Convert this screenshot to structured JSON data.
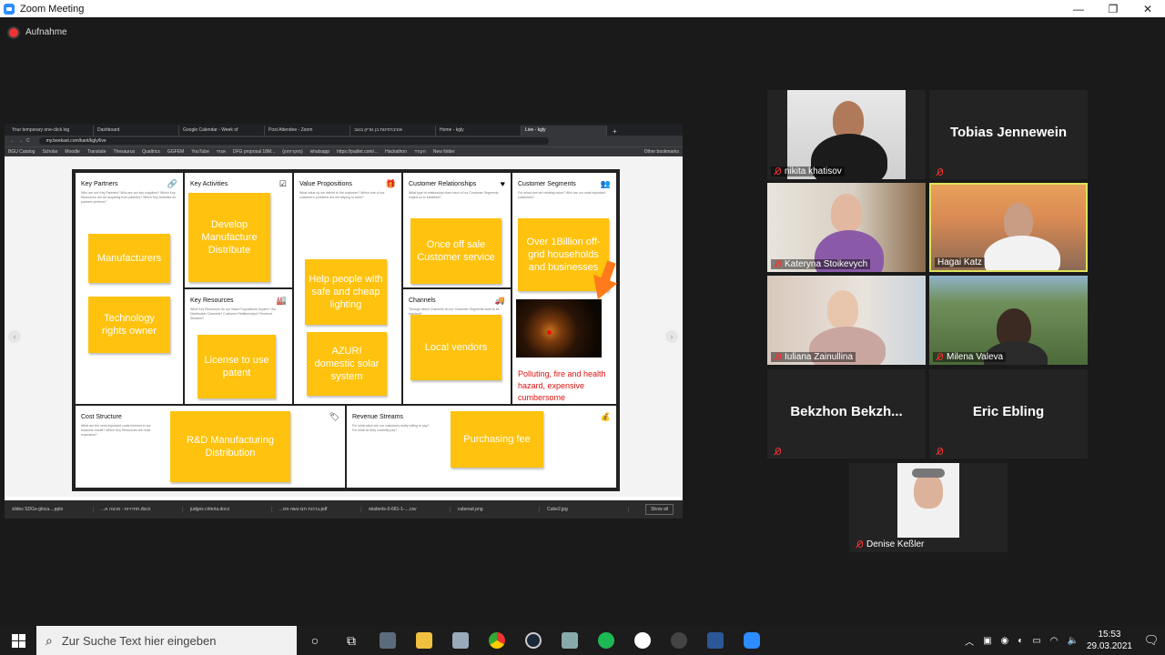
{
  "window": {
    "title": "Zoom Meeting"
  },
  "recording": {
    "label": "Aufnahme"
  },
  "browser": {
    "tabs": [
      "Your temporary one-click log",
      "Dashboard",
      "Google Calendar - Week of",
      "Post Attendee - Zoom",
      "אוניברסיטת בן גוריון בנגב",
      "Home - kgly",
      "Live - kgly"
    ],
    "url": "my.beekast.com/kant/kgly/live",
    "bookmarks": [
      "BGU Catalog",
      "Scholar",
      "Moodle",
      "Translate",
      "Thesaurus",
      "Qualtrics",
      "GGFEM",
      "YouTube",
      "אגתי",
      "DFG proposal 18M...",
      "(מוקרותוון)",
      "whatsapp",
      "https://padlet.com/...",
      "Hackathon",
      "הקורד",
      "New folder"
    ],
    "other_bookmarks": "Other bookmarks"
  },
  "canvas": {
    "key_partners": {
      "title": "Key Partners",
      "notes": [
        "Manufacturers",
        "Technology rights owner"
      ],
      "q": "Who are our Key Partners? Who are our key suppliers? Which Key Resources are we acquiring from partners? Which Key Activities do partners perform?"
    },
    "key_activities": {
      "title": "Key Activities",
      "notes": [
        "Develop Manufacture Distribute"
      ]
    },
    "key_resources": {
      "title": "Key Resources",
      "notes": [
        "License to use patent"
      ],
      "q": "What Key Resources do our Value Propositions require? Our Distribution Channels? Customer Relationships? Revenue Streams?"
    },
    "value_propositions": {
      "title": "Value Propositions",
      "notes": [
        "Help people with safe and cheap lighting",
        "AZURI domestic solar system"
      ],
      "q": "What value do we deliver to the customer? Which one of our customer's problems are we helping to solve?"
    },
    "customer_relationships": {
      "title": "Customer Relationships",
      "notes": [
        "Once off sale Customer service"
      ],
      "q": "What type of relationship does each of our Customer Segments expect us to establish?"
    },
    "channels": {
      "title": "Channels",
      "notes": [
        "Local vendors"
      ],
      "q": "Through which Channels do our Customer Segments want to be reached?"
    },
    "customer_segments": {
      "title": "Customer Segments",
      "notes": [
        "Over 1Billion off-grid households and businesses"
      ],
      "q": "For whom are we creating value? Who are our most important customers?",
      "red_text": "Polluting, fire and health hazard, expensive cumbersome"
    },
    "cost_structure": {
      "title": "Cost Structure",
      "notes": [
        "R&D Manufacturing Distribution"
      ],
      "q": "What are the most important costs inherent in our business model? Which Key Resources are most expensive?"
    },
    "revenue_streams": {
      "title": "Revenue Streams",
      "notes": [
        "Purchasing fee"
      ],
      "q": "For what value are our customers really willing to pay? For what do they currently pay?"
    }
  },
  "downloads": {
    "files": [
      "slides SDGs-gloca....pptx",
      "...תחרויות - מכונה א.docx",
      "judges criteria.docx",
      "...ברכות תם עשה פס.pdf",
      "students-0-681-1-....csv",
      "cubeout.png",
      "Cube2.jpg"
    ],
    "show_all": "Show all"
  },
  "participants": [
    {
      "name": "nikita khatisov",
      "big": ""
    },
    {
      "name": "",
      "big": "Tobias Jennewein"
    },
    {
      "name": "Kateryna Stoikevych",
      "big": ""
    },
    {
      "name": "Hagai Katz",
      "big": ""
    },
    {
      "name": "Iuliana Zainullina",
      "big": ""
    },
    {
      "name": "Milena Valeva",
      "big": ""
    },
    {
      "name": "",
      "big": "Bekzhon  Bekzh..."
    },
    {
      "name": "",
      "big": "Eric Ebling"
    },
    {
      "name": "Denise Keßler",
      "big": ""
    }
  ],
  "taskbar": {
    "search_placeholder": "Zur Suche Text hier eingeben",
    "time": "15:53",
    "date": "29.03.2021"
  }
}
